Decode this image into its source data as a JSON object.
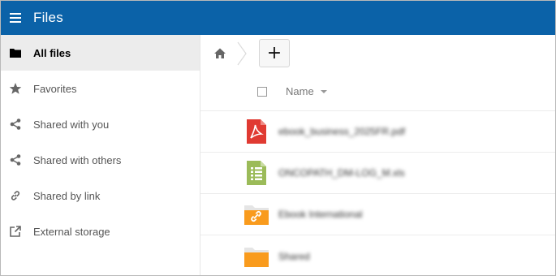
{
  "header": {
    "title": "Files"
  },
  "sidebar": {
    "items": [
      {
        "label": "All files",
        "icon": "folder-icon",
        "active": true
      },
      {
        "label": "Favorites",
        "icon": "star-icon",
        "active": false
      },
      {
        "label": "Shared with you",
        "icon": "share-icon",
        "active": false
      },
      {
        "label": "Shared with others",
        "icon": "share-icon",
        "active": false
      },
      {
        "label": "Shared by link",
        "icon": "link-icon",
        "active": false
      },
      {
        "label": "External storage",
        "icon": "external-storage-icon",
        "active": false
      }
    ]
  },
  "controls": {
    "new_label": "+"
  },
  "file_list": {
    "columns": {
      "name": "Name"
    },
    "files": [
      {
        "name": "ebook_business_2025FR.pdf",
        "type": "pdf",
        "icon": "pdf-icon"
      },
      {
        "name": "ONCOPATH_DM-LOG_M.xls",
        "type": "spreadsheet",
        "icon": "spreadsheet-icon"
      },
      {
        "name": "Ebook International",
        "type": "shared-folder",
        "icon": "shared-folder-icon"
      },
      {
        "name": "Shared",
        "type": "folder",
        "icon": "folder-icon"
      }
    ]
  },
  "colors": {
    "header_bg": "#0b62a8",
    "pdf": "#e03a32",
    "spreadsheet": "#9bbb59",
    "folder": "#f99b1d"
  }
}
